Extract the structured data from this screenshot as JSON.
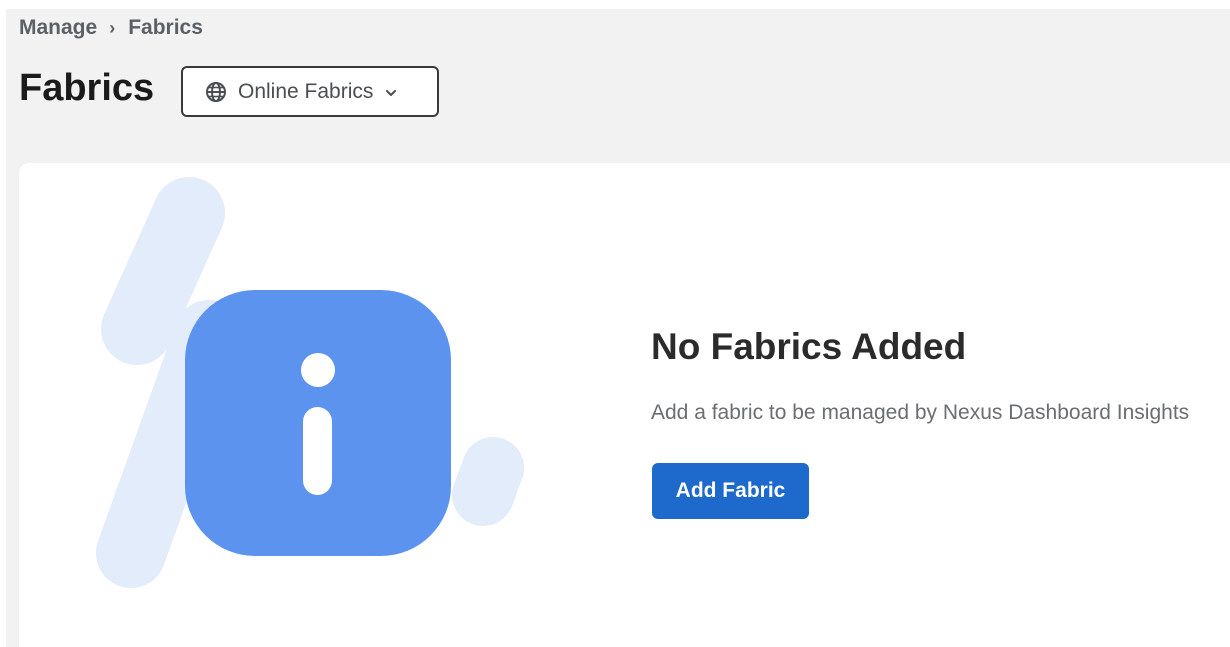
{
  "breadcrumb": {
    "items": [
      "Manage",
      "Fabrics"
    ],
    "separator": "›"
  },
  "header": {
    "title": "Fabrics",
    "fabric_filter": {
      "selected": "Online Fabrics",
      "icon": "globe-icon",
      "caret_icon": "chevron-down-icon"
    }
  },
  "empty_state": {
    "icon": "info-icon",
    "title": "No Fabrics Added",
    "description": "Add a fabric to be managed by Nexus Dashboard Insights",
    "action_label": "Add Fabric"
  },
  "colors": {
    "primary": "#1d69cc",
    "info_icon": "#5b93ee",
    "illustration_accent": "#e3ecfb",
    "page_background": "#f2f2f2"
  }
}
